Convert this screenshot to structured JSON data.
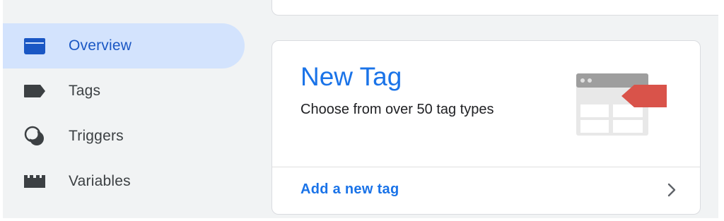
{
  "sidebar": {
    "items": [
      {
        "label": "Overview",
        "icon": "folder-icon",
        "active": true
      },
      {
        "label": "Tags",
        "icon": "tag-icon",
        "active": false
      },
      {
        "label": "Triggers",
        "icon": "trigger-icon",
        "active": false
      },
      {
        "label": "Variables",
        "icon": "variables-icon",
        "active": false
      }
    ]
  },
  "new_tag_card": {
    "title": "New Tag",
    "description": "Choose from over 50 tag types",
    "action_label": "Add a new tag",
    "illustration": "tag-browser-illustration"
  },
  "colors": {
    "active_bg": "#d3e3fd",
    "accent": "#1a73e8",
    "active_icon": "#1a57c4",
    "icon_gray": "#3c4043",
    "tag_red": "#d9534a",
    "page_bg": "#f1f3f4"
  }
}
